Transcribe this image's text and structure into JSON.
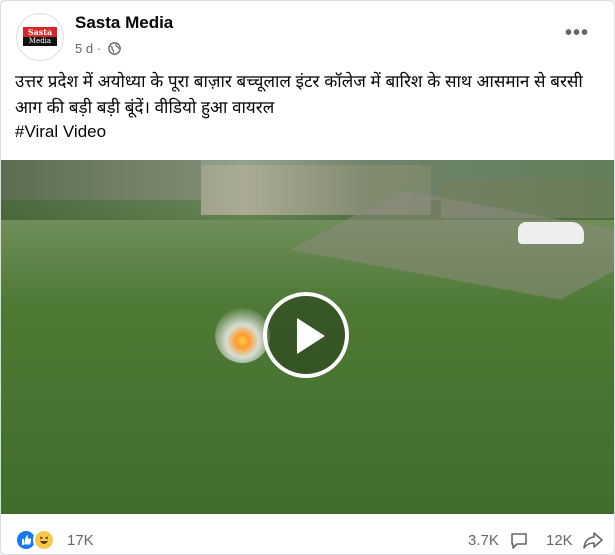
{
  "post": {
    "page_name": "Sasta Media",
    "time": "5 d ·",
    "avatar_logo_top": "Sasta",
    "avatar_logo_bottom": "Media",
    "text": "उत्तर प्रदेश में अयोध्या के पूरा बाज़ार बच्चूलाल इंटर कॉलेज में बारिश के साथ आसमान से बरसी आग की बड़ी बड़ी बूंदें। वीडियो हुआ वायरल",
    "hashtag": "#Viral Video",
    "more_label": "•••"
  },
  "stats": {
    "reactions": "17K",
    "comments": "3.7K",
    "shares": "12K"
  },
  "icons": {
    "globe": "globe-icon",
    "more": "more-options-icon",
    "play": "play-icon",
    "like": "like-reaction-icon",
    "haha": "haha-reaction-icon",
    "comment": "comment-icon",
    "share": "share-icon"
  },
  "colors": {
    "brand_blue": "#1877f2",
    "text": "#050505",
    "secondary_text": "#65676b"
  }
}
